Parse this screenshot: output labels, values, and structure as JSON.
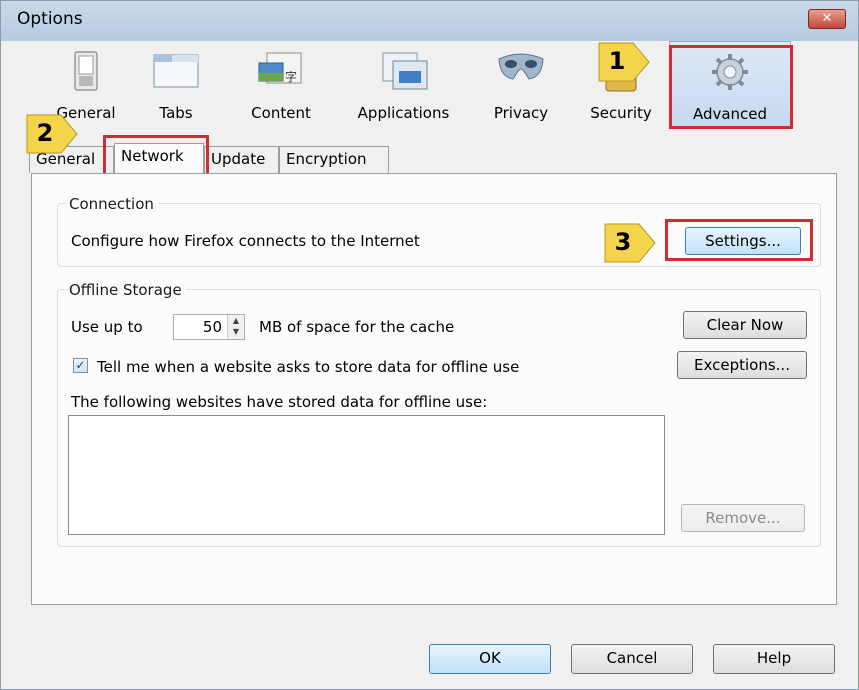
{
  "window": {
    "title": "Options",
    "close_label": "✕"
  },
  "toolbar": {
    "items": [
      {
        "label": "General",
        "icon": "general-switch-icon"
      },
      {
        "label": "Tabs",
        "icon": "tabs-window-icon"
      },
      {
        "label": "Content",
        "icon": "content-picture-icon"
      },
      {
        "label": "Applications",
        "icon": "applications-window-icon"
      },
      {
        "label": "Privacy",
        "icon": "privacy-mask-icon"
      },
      {
        "label": "Security",
        "icon": "security-lock-icon"
      },
      {
        "label": "Advanced",
        "icon": "advanced-gear-icon"
      }
    ],
    "selected": "Advanced"
  },
  "tabs": {
    "items": [
      "General",
      "Network",
      "Update",
      "Encryption"
    ],
    "active": "Network"
  },
  "connection": {
    "legend": "Connection",
    "description": "Configure how Firefox connects to the Internet",
    "settings_button": "Settings..."
  },
  "offline_storage": {
    "legend": "Offline Storage",
    "use_up_to_label": "Use up to",
    "cache_value": "50",
    "cache_suffix": "MB of space for the cache",
    "clear_now_button": "Clear Now",
    "tell_me_label": "Tell me when a website asks to store data for offline use",
    "tell_me_checked": true,
    "exceptions_button": "Exceptions...",
    "websites_label": "The following websites have stored data for offline use:",
    "websites": [],
    "remove_button": "Remove..."
  },
  "annotations": {
    "badge1": "1",
    "badge2": "2",
    "badge3": "3",
    "highlight_color": "#d32a36",
    "badge_color": "#f3d44a"
  },
  "footer": {
    "ok_button": "OK",
    "cancel_button": "Cancel",
    "help_button": "Help"
  }
}
